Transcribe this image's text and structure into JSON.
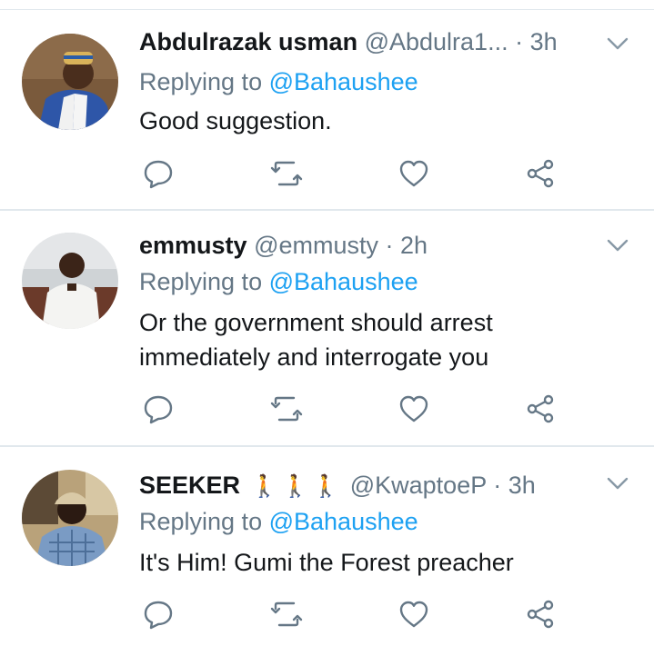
{
  "tweets": [
    {
      "name": "Abdulrazak usman",
      "handle": "@Abdulra1...",
      "time": "3h",
      "reply_prefix": "Replying to",
      "reply_to": "@Bahaushee",
      "text": "Good suggestion.",
      "avatar_icon": "avatar-photo"
    },
    {
      "name": "emmusty",
      "handle": "@emmusty",
      "time": "2h",
      "reply_prefix": "Replying to",
      "reply_to": "@Bahaushee",
      "text": "Or the government should arrest immediately and interrogate you",
      "avatar_icon": "avatar-photo"
    },
    {
      "name": "SEEKER",
      "name_emoji": "🚶🚶🚶",
      "handle": "@KwaptoeP",
      "time": "3h",
      "reply_prefix": "Replying to",
      "reply_to": "@Bahaushee",
      "text": "It's Him! Gumi the Forest preacher",
      "avatar_icon": "avatar-photo"
    }
  ],
  "separator": "·",
  "icons": [
    "chevron-down-icon",
    "reply-icon",
    "retweet-icon",
    "like-icon",
    "share-icon"
  ],
  "colors": {
    "accent": "#1da1f2",
    "secondary_text": "#657786",
    "divider": "#e1e8ed"
  }
}
